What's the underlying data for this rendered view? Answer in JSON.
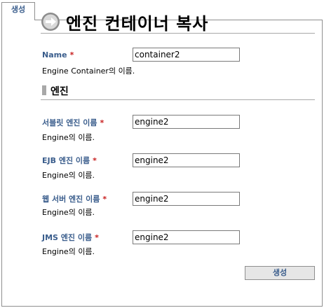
{
  "tab": {
    "label": "생성"
  },
  "page": {
    "title": "엔진 컨테이너 복사"
  },
  "container": {
    "label": "Name",
    "required_mark": "*",
    "value": "container2",
    "help": "Engine Container의 이름."
  },
  "section": {
    "title": "엔진"
  },
  "engines": [
    {
      "label": "서블릿 엔진 이름",
      "required_mark": "*",
      "value": "engine2",
      "help": "Engine의 이름."
    },
    {
      "label": "EJB 엔진 이름",
      "required_mark": "*",
      "value": "engine2",
      "help": "Engine의 이름."
    },
    {
      "label": "웹 서버 엔진 이름",
      "required_mark": "*",
      "value": "engine2",
      "help": "Engine의 이름."
    },
    {
      "label": "JMS 엔진 이름",
      "required_mark": "*",
      "value": "engine2",
      "help": "Engine의 이름."
    }
  ],
  "actions": {
    "create_label": "생성"
  },
  "colors": {
    "label": "#3a5d8c",
    "required": "#c81e1e",
    "border": "#8f8f8f",
    "rule": "#a8a8a8"
  },
  "icons": {
    "title": "arrow-circle-icon"
  }
}
